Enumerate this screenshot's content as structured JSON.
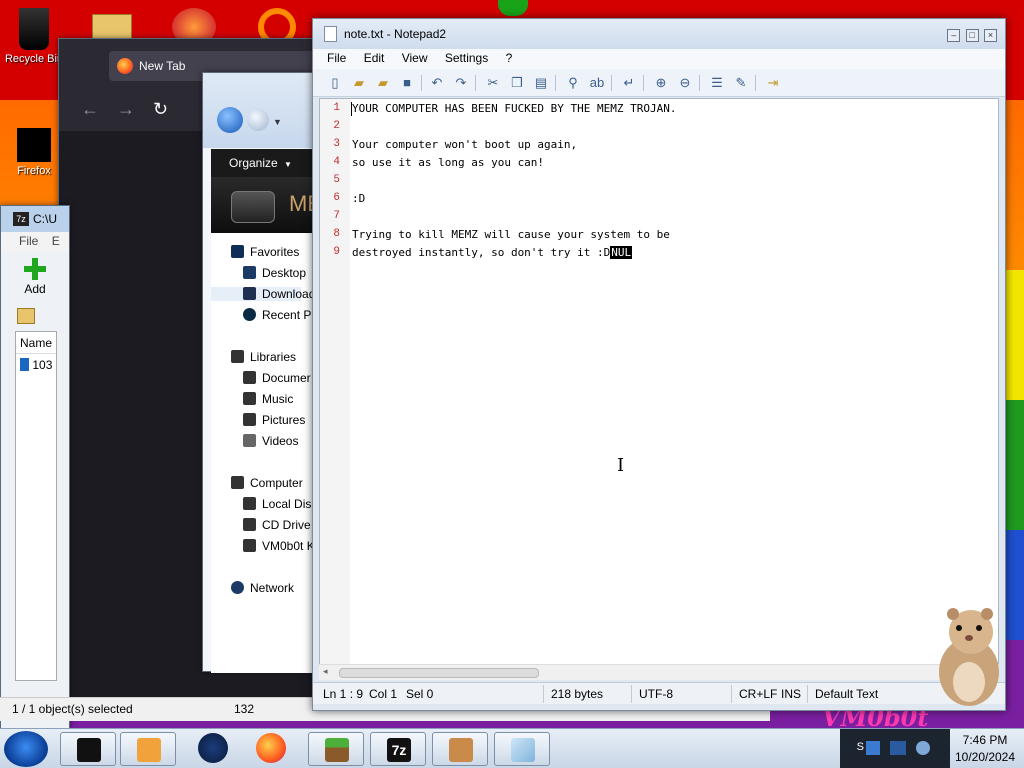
{
  "desktop": {
    "icons": [
      {
        "label": "Recycle Bin"
      },
      {
        "label": "Firefox"
      }
    ],
    "bottom_banner": "VM0b0t"
  },
  "zip_window": {
    "title": "C:\\U",
    "menu": [
      "File",
      "E"
    ],
    "add_label": "Add",
    "column_name": "Name",
    "row_label": "103",
    "status_selected": "1 / 1 object(s) selected",
    "status_size": "132"
  },
  "firefox": {
    "tab_title": "New Tab"
  },
  "explorer": {
    "organize": "Organize",
    "banner_text": "ME",
    "favorites": "Favorites",
    "fav_items": [
      "Desktop",
      "Download",
      "Recent Pl"
    ],
    "libraries": "Libraries",
    "lib_items": [
      "Documer",
      "Music",
      "Pictures",
      "Videos"
    ],
    "computer": "Computer",
    "comp_items": [
      "Local Disk",
      "CD Drive",
      "VM0b0t K"
    ],
    "network": "Network"
  },
  "notepad": {
    "title": "note.txt - Notepad2",
    "menu": [
      "File",
      "Edit",
      "View",
      "Settings",
      "?"
    ],
    "lines": [
      {
        "n": "1",
        "text": "YOUR COMPUTER HAS BEEN FUCKED BY THE MEMZ TROJAN."
      },
      {
        "n": "2",
        "text": ""
      },
      {
        "n": "3",
        "text": "Your computer won't boot up again,"
      },
      {
        "n": "4",
        "text": "so use it as long as you can!"
      },
      {
        "n": "5",
        "text": ""
      },
      {
        "n": "6",
        "text": ":D"
      },
      {
        "n": "7",
        "text": ""
      },
      {
        "n": "8",
        "text": "Trying to kill MEMZ will cause your system to be"
      },
      {
        "n": "9",
        "text": "destroyed instantly, so don't try it :D"
      }
    ],
    "nul_marker": "NUL",
    "status": {
      "position": "Ln 1 : 9",
      "column": "Col 1",
      "selection": "Sel 0",
      "size": "218 bytes",
      "encoding": "UTF-8",
      "line_ending": "CR+LF",
      "mode": "INS",
      "scheme": "Default Text"
    }
  },
  "taskbar": {
    "clock_time": "7:46 PM",
    "clock_date": "10/20/2024",
    "tray_text": "S",
    "apps": [
      "terminal-app",
      "media-player-app",
      "earth-app",
      "firefox-app",
      "minecraft-app",
      "7zip-app",
      "hamster-app",
      "notepad-app"
    ],
    "zip_label": "7z"
  }
}
